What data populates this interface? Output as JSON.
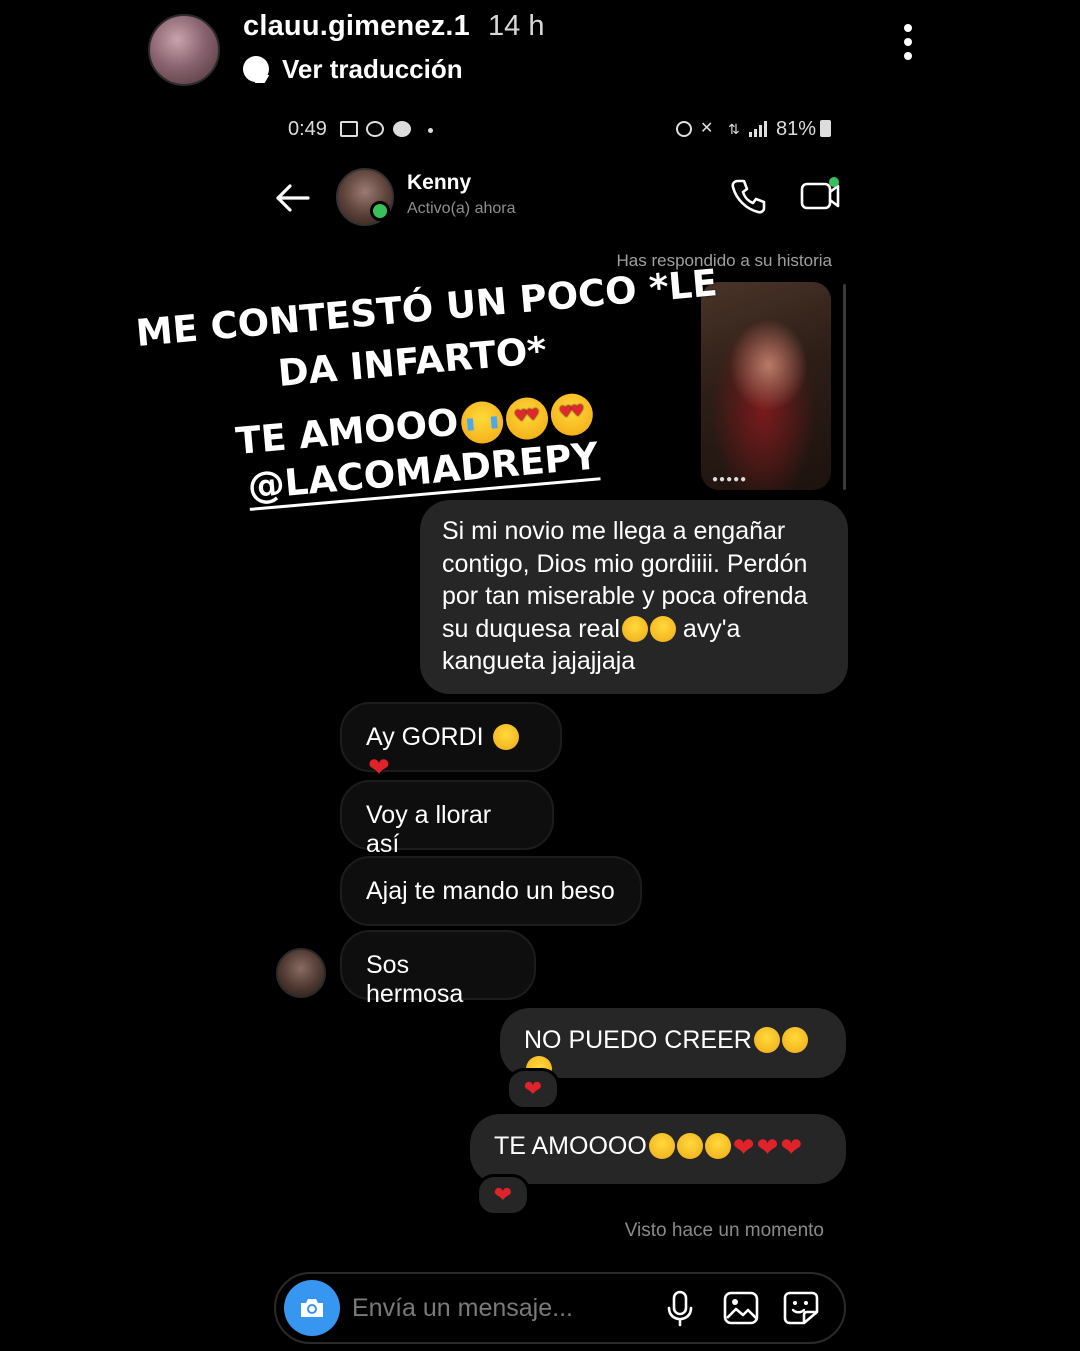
{
  "story_header": {
    "username": "clauu.gimenez.1",
    "time": "14 h",
    "translate_label": "Ver traducción"
  },
  "status_bar": {
    "time": "0:49",
    "battery": "81%"
  },
  "chat_header": {
    "contact_name": "Kenny",
    "contact_status": "Activo(a) ahora"
  },
  "story_reply_note": "Has respondido a su historia",
  "overlay_text": {
    "line1": "ME CONTESTÓ UN POCO *LE",
    "line2": "DA INFARTO*",
    "line3": "TE AMOOO",
    "line4": "@LACOMADREPY"
  },
  "messages": {
    "long_reply": "Si mi novio me llega a engañar\ncontigo, Dios mio gordiiii. Perdón\npor tan miserable y poca ofrenda\nsu duquesa real",
    "long_reply_tail_a": " avy'a",
    "long_reply_tail_b": "kangueta jajajjaja",
    "m1": "Ay GORDI ",
    "m2": "Voy a llorar así",
    "m3": "Ajaj te mando un beso",
    "m4": "Sos hermosa",
    "m5": "NO PUEDO CREER",
    "m6": "TE AMOOOO"
  },
  "reactions": [
    "❤",
    "❤"
  ],
  "seen_label": "Visto hace un momento",
  "composer": {
    "placeholder": "Envía un mensaje..."
  },
  "icons": [
    "translate-icon",
    "more-icon",
    "back-arrow-icon",
    "phone-icon",
    "video-icon",
    "camera-icon",
    "mic-icon",
    "gallery-icon",
    "sticker-icon"
  ],
  "colors": {
    "background": "#000000",
    "bubble": "#262626",
    "accent_blue": "#3797f0",
    "online_green": "#3ac05a",
    "heart_red": "#e0222b"
  }
}
